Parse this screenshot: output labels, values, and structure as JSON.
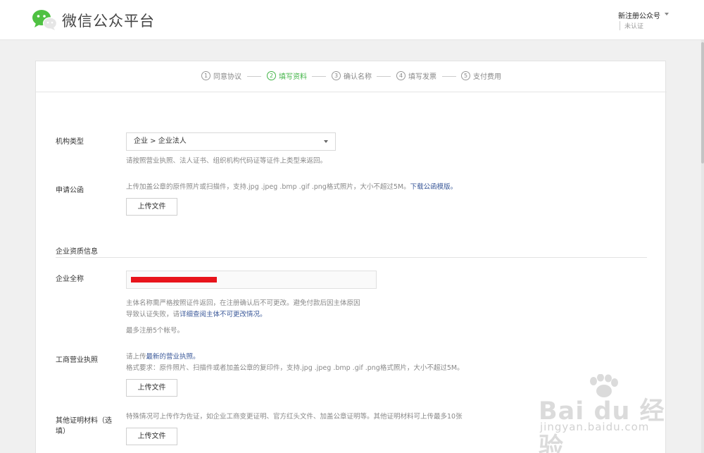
{
  "header": {
    "brand": "微信公众平台",
    "account_name": "新注册公众号",
    "verify_status": "未认证"
  },
  "steps": [
    {
      "num": "1",
      "label": "同意协议"
    },
    {
      "num": "2",
      "label": "填写资料"
    },
    {
      "num": "3",
      "label": "确认名称"
    },
    {
      "num": "4",
      "label": "填写发票"
    },
    {
      "num": "5",
      "label": "支付费用"
    }
  ],
  "active_step_color": "#44b549",
  "form": {
    "org_type": {
      "label": "机构类型",
      "value": "企业 > 企业法人",
      "hint": "请按照营业执照、法人证书、组织机构代码证等证件上类型来返回。"
    },
    "letter": {
      "label": "申请公函",
      "hint": "上传加盖公章的原件照片或扫描件，支持.jpg .jpeg .bmp .gif .png格式照片，大小不超过5M。",
      "link": "下载公函模版。",
      "button": "上传文件"
    },
    "section_title": "企业资质信息",
    "full_name": {
      "label": "企业全称",
      "hint_line1": "主体名称需严格按照证件返回，在注册确认后不可更改。避免付款后因主体原因",
      "hint_line2_prefix": "导致认证失败，请",
      "hint_line2_link": "详细查阅主体不可更改情况。",
      "hint_line3": "最多注册5个帐号。"
    },
    "license": {
      "label": "工商营业执照",
      "hint_prefix": "请上传",
      "hint_link": "最新的营业执照。",
      "format": "格式要求：原件照片、扫描件或者加盖公章的复印件，支持.jpg .jpeg .bmp .gif .png格式照片，大小不超过5M。",
      "button": "上传文件"
    },
    "other": {
      "label_line1": "其他证明材料（选",
      "label_line2": "填）",
      "hint": "特殊情况可上传作为佐证，如企业工商变更证明、官方红头文件、加盖公章证明等。其他证明材料可上传最多10张",
      "button": "上传文件"
    }
  },
  "watermark": {
    "logo_text": "Bai du 经验",
    "url": "jingyan.baidu.com"
  }
}
